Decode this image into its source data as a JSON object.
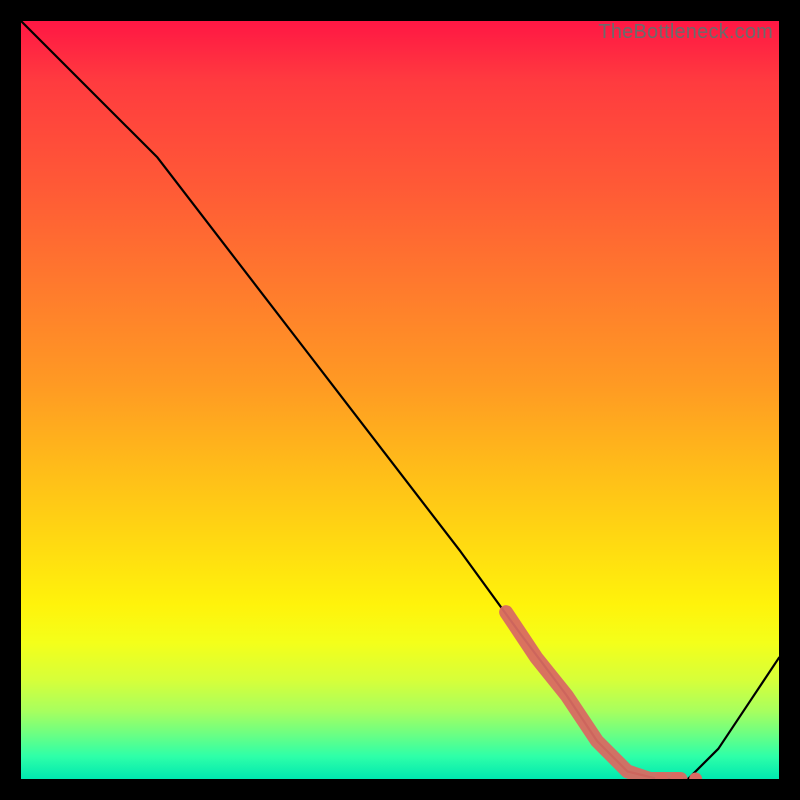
{
  "watermark": "TheBottleneck.com",
  "colors": {
    "frame": "#000000",
    "curve": "#000000",
    "marker_stroke": "#c05050",
    "marker_fill": "#d86a62",
    "gradient_top": "#ff1744",
    "gradient_bottom": "#00e8b0"
  },
  "chart_data": {
    "type": "line",
    "title": "",
    "xlabel": "",
    "ylabel": "",
    "xlim": [
      0,
      100
    ],
    "ylim": [
      0,
      100
    ],
    "series": [
      {
        "name": "bottleneck-curve",
        "x": [
          0,
          8,
          18,
          28,
          38,
          48,
          58,
          66,
          72,
          76,
          80,
          84,
          88,
          92,
          96,
          100
        ],
        "values": [
          100,
          92,
          82,
          69,
          56,
          43,
          30,
          19,
          11,
          5,
          1,
          0,
          0,
          4,
          10,
          16
        ]
      }
    ],
    "highlight_segment": {
      "name": "optimal-range",
      "x": [
        64,
        68,
        72,
        76,
        80,
        83,
        85,
        87
      ],
      "values": [
        22,
        16,
        11,
        5,
        1,
        0,
        0,
        0
      ]
    },
    "highlight_dots": {
      "name": "optimal-dots",
      "x": [
        84.5,
        86.5,
        89
      ],
      "values": [
        0,
        0,
        0
      ]
    }
  }
}
